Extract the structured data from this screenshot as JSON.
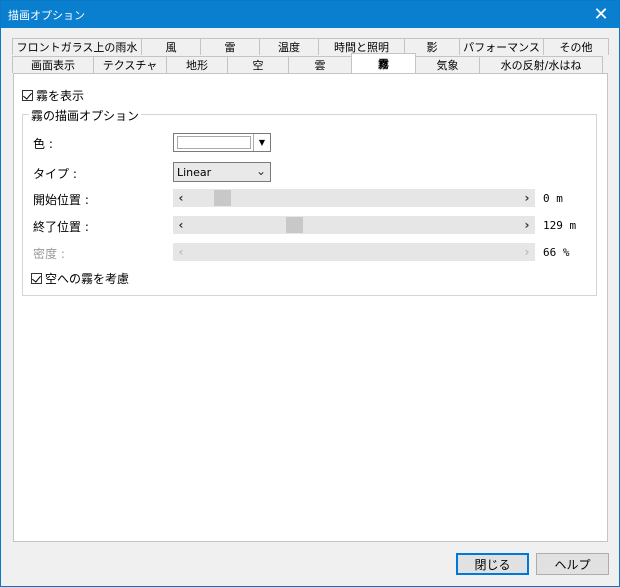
{
  "window": {
    "title": "描画オプション"
  },
  "tabs_row1": [
    "フロントガラス上の雨水",
    "風",
    "雷",
    "温度",
    "時間と照明",
    "影",
    "パフォーマンス",
    "その他"
  ],
  "tabs_row2": [
    "画面表示",
    "テクスチャ",
    "地形",
    "空",
    "雲",
    "霧",
    "気象",
    "水の反射/水はね"
  ],
  "active_tab": "霧",
  "fog": {
    "show_label": "霧を表示",
    "group_title": "霧の描画オプション",
    "color_label": "色 :",
    "type_label": "タイプ :",
    "type_value": "Linear",
    "start_label": "開始位置 :",
    "start_value": "0 m",
    "start_fraction": 0.08,
    "end_label": "終了位置 :",
    "end_value": "129 m",
    "end_fraction": 0.31,
    "density_label": "密度 :",
    "density_value": "66 %",
    "sky_label": "空への霧を考慮"
  },
  "buttons": {
    "close": "閉じる",
    "help": "ヘルプ"
  }
}
